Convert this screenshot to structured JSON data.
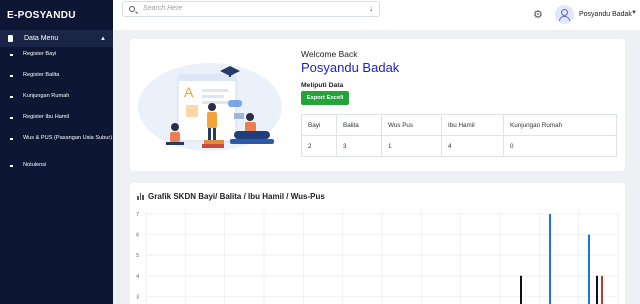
{
  "app": {
    "title": "E-POSYANDU"
  },
  "sidebar": {
    "section": "Data Menu",
    "items": [
      {
        "label": "Register Bayi"
      },
      {
        "label": "Register Balita"
      },
      {
        "label": "Kunjungan Rumah"
      },
      {
        "label": "Register Ibu Hamil"
      },
      {
        "label": "Wus & PUS (Pasangan Usia Subur)"
      },
      {
        "label": "Notulensi"
      }
    ]
  },
  "topbar": {
    "search_placeholder": "Search Here",
    "user_name": "Posyandu Badak",
    "icons": [
      "search-icon",
      "download-icon",
      "gear-icon",
      "user-avatar-icon",
      "chevron-down-icon"
    ]
  },
  "welcome": {
    "greeting": "Welcome Back",
    "name": "Posyandu Badak",
    "subtitle": "Meliputi Data",
    "export_label": "Export Excell",
    "table": {
      "headers": [
        "Bayi",
        "Balita",
        "Wus Pus",
        "Ibu Hamil",
        "Kunjungan Rumah"
      ],
      "values": [
        "2",
        "3",
        "1",
        "4",
        "0"
      ]
    }
  },
  "chart_data": {
    "type": "bar",
    "title": "Grafik SKDN Bayi/ Balita / Ibu Hamil / Wus-Pus",
    "ylim": [
      0,
      7
    ],
    "y_ticks": [
      "7",
      "6",
      "5",
      "4",
      "3"
    ],
    "grid": true,
    "series": [
      {
        "color": "#111111",
        "values": [
          4
        ]
      },
      {
        "color": "#1a73e8",
        "values": [
          7
        ]
      },
      {
        "color": "#1a73e8",
        "values": [
          6
        ]
      },
      {
        "color": "#111111",
        "values": [
          4
        ]
      },
      {
        "color": "#c0392b",
        "values": [
          4
        ]
      }
    ]
  },
  "colors": {
    "sidebar": "#0d1733",
    "accent": "#1b1fcc",
    "export": "#22a43a"
  }
}
